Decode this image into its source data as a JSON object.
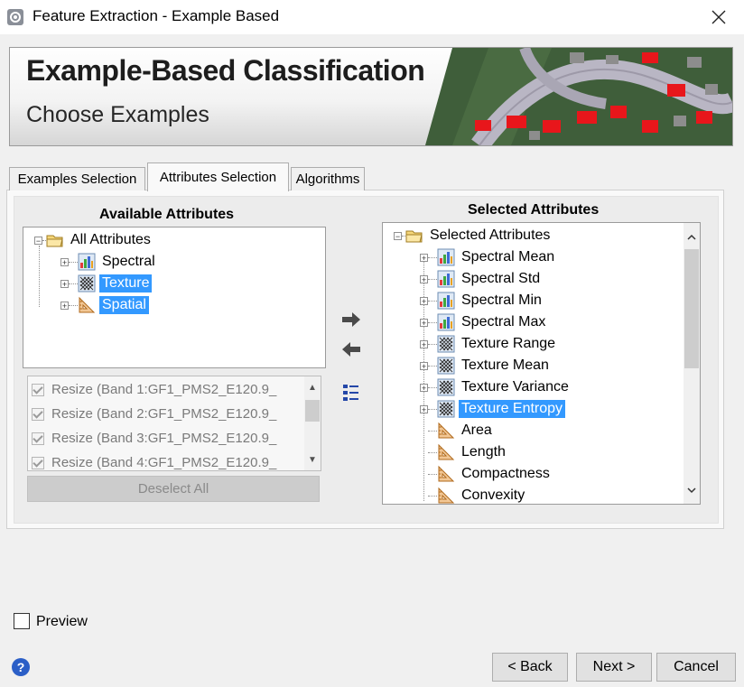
{
  "window": {
    "title": "Feature Extraction - Example Based"
  },
  "banner": {
    "title": "Example-Based Classification",
    "subtitle": "Choose Examples"
  },
  "tabs": [
    {
      "label": "Examples Selection",
      "active": false
    },
    {
      "label": "Attributes Selection",
      "active": true
    },
    {
      "label": "Algorithms",
      "active": false
    }
  ],
  "available": {
    "heading": "Available Attributes",
    "root": "All Attributes",
    "items": [
      {
        "label": "Spectral",
        "icon": "spectral-icon",
        "selected": false
      },
      {
        "label": "Texture",
        "icon": "texture-icon",
        "selected": true
      },
      {
        "label": "Spatial",
        "icon": "spatial-icon",
        "selected": true
      }
    ]
  },
  "bands": [
    "Resize (Band 1:GF1_PMS2_E120.9_",
    "Resize (Band 2:GF1_PMS2_E120.9_",
    "Resize (Band 3:GF1_PMS2_E120.9_",
    "Resize (Band 4:GF1_PMS2_E120.9_"
  ],
  "deselect_label": "Deselect All",
  "selected": {
    "heading": "Selected Attributes",
    "root": "Selected Attributes",
    "items": [
      {
        "label": "Spectral Mean",
        "icon": "spectral-icon",
        "expandable": true,
        "selected": false
      },
      {
        "label": "Spectral Std",
        "icon": "spectral-icon",
        "expandable": true,
        "selected": false
      },
      {
        "label": "Spectral Min",
        "icon": "spectral-icon",
        "expandable": true,
        "selected": false
      },
      {
        "label": "Spectral Max",
        "icon": "spectral-icon",
        "expandable": true,
        "selected": false
      },
      {
        "label": "Texture Range",
        "icon": "texture-icon",
        "expandable": true,
        "selected": false
      },
      {
        "label": "Texture Mean",
        "icon": "texture-icon",
        "expandable": true,
        "selected": false
      },
      {
        "label": "Texture Variance",
        "icon": "texture-icon",
        "expandable": true,
        "selected": false
      },
      {
        "label": "Texture Entropy",
        "icon": "texture-icon",
        "expandable": true,
        "selected": true
      },
      {
        "label": "Area",
        "icon": "spatial-icon",
        "expandable": false,
        "selected": false
      },
      {
        "label": "Length",
        "icon": "spatial-icon",
        "expandable": false,
        "selected": false
      },
      {
        "label": "Compactness",
        "icon": "spatial-icon",
        "expandable": false,
        "selected": false
      },
      {
        "label": "Convexity",
        "icon": "spatial-icon",
        "expandable": false,
        "selected": false
      }
    ]
  },
  "preview": {
    "label": "Preview",
    "checked": false
  },
  "buttons": {
    "back": "< Back",
    "next": "Next >",
    "cancel": "Cancel"
  },
  "colors": {
    "selection": "#3399ff",
    "accent_red": "#e8161b"
  }
}
